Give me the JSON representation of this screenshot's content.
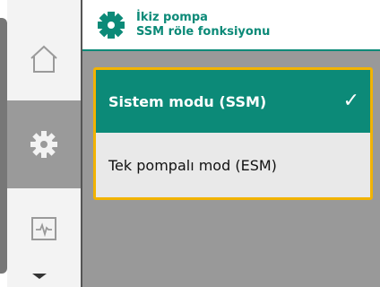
{
  "header": {
    "title_line1": "İkiz pompa",
    "title_line2": "SSM röle fonksiyonu",
    "icon": "gear-icon"
  },
  "sidebar": {
    "items": [
      {
        "icon": "home-icon"
      },
      {
        "icon": "settings-gear-icon",
        "active": true
      },
      {
        "icon": "diagnostics-icon"
      }
    ],
    "scroll_icon": "arrow-down-icon"
  },
  "options": [
    {
      "label": "Sistem modu (SSM)",
      "selected": true,
      "check": "✓"
    },
    {
      "label": "Tek pompalı mod (ESM)",
      "selected": false
    }
  ],
  "colors": {
    "accent": "#0c8a78",
    "focus": "#f2b300",
    "background": "#999999"
  }
}
